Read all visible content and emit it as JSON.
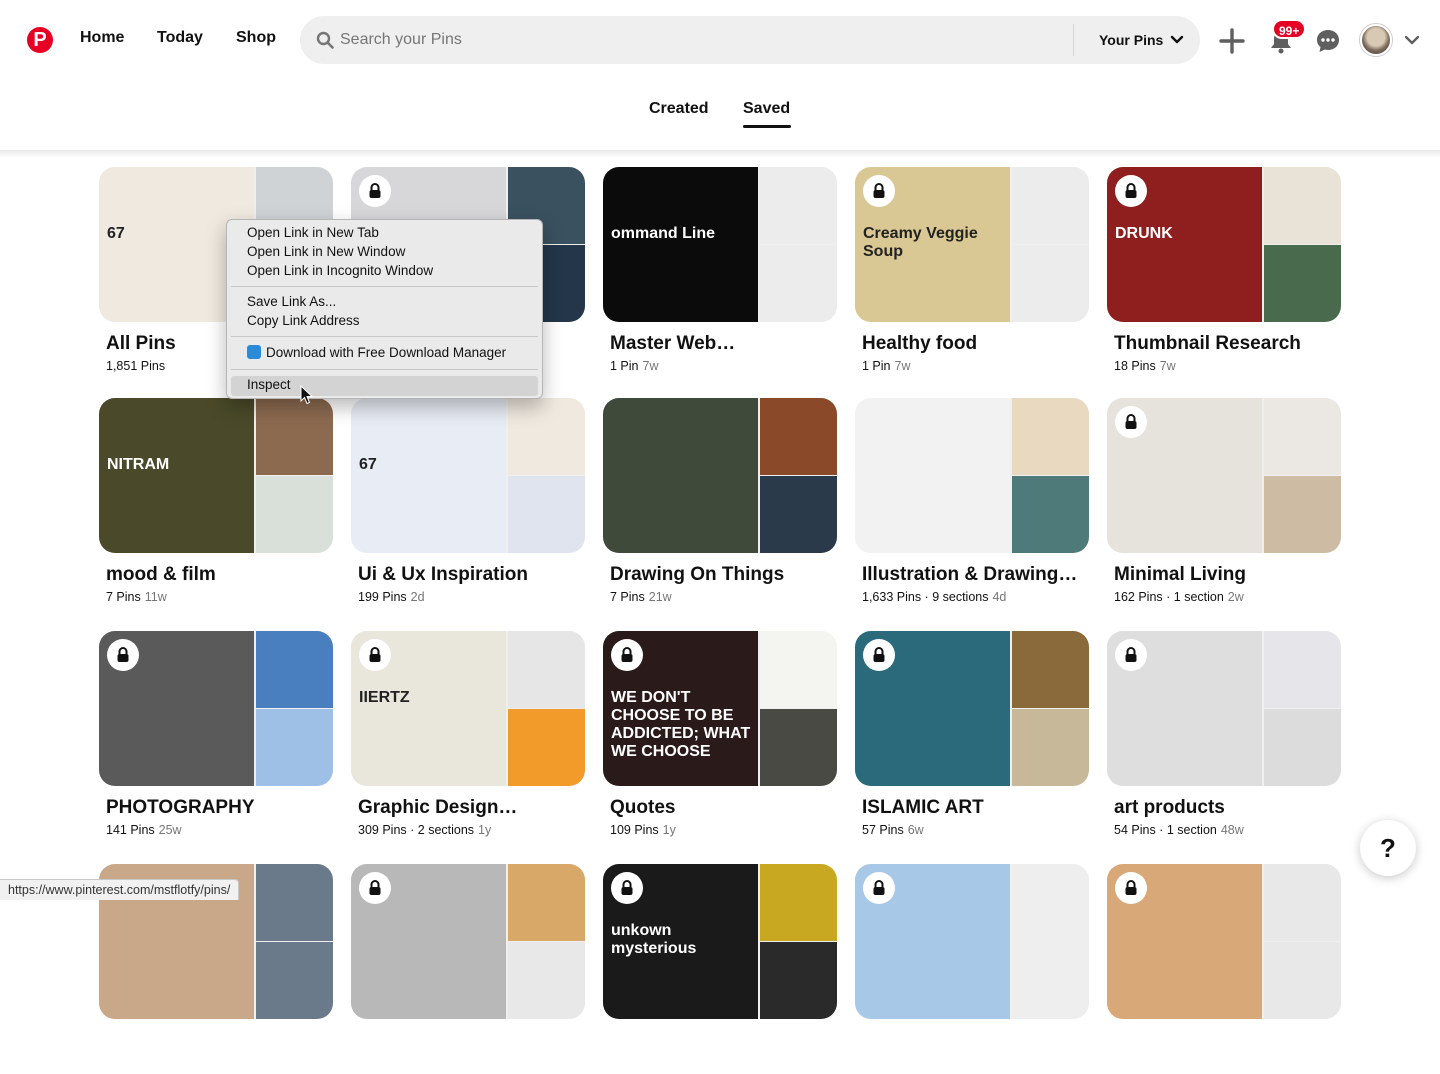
{
  "header": {
    "logo": "P",
    "nav": [
      "Home",
      "Today",
      "Shop"
    ],
    "search_placeholder": "Search your Pins",
    "your_pins": "Your Pins",
    "notifications_badge": "99+"
  },
  "tabs": {
    "created": "Created",
    "saved": "Saved",
    "active": "Saved"
  },
  "boards": [
    {
      "title": "All Pins",
      "pins": "1,851 Pins",
      "sections": "",
      "age": "",
      "locked": false,
      "colors": [
        "#efe9df",
        "#cfd3d6",
        "#e8e8ea"
      ],
      "cover_label": "67"
    },
    {
      "title": "",
      "pins": "",
      "sections": "",
      "age": "",
      "locked": true,
      "colors": [
        "#d7d7d9",
        "#3a5160",
        "#23364a"
      ],
      "cover_label": ""
    },
    {
      "title": "Master Web…",
      "pins": "1 Pin",
      "sections": "",
      "age": "7w",
      "locked": false,
      "colors": [
        "#0b0b0b",
        "#ececec",
        "#ececec"
      ],
      "cover_label": "ommand Line"
    },
    {
      "title": "Healthy food",
      "pins": "1 Pin",
      "sections": "",
      "age": "7w",
      "locked": true,
      "colors": [
        "#d9c894",
        "#ececec",
        "#ececec"
      ],
      "cover_label": "Creamy Veggie Soup"
    },
    {
      "title": "Thumbnail Research",
      "pins": "18 Pins",
      "sections": "",
      "age": "7w",
      "locked": true,
      "colors": [
        "#8f1e1e",
        "#e8e3d6",
        "#4a6a4e"
      ],
      "cover_label": "DRUNK"
    },
    {
      "title": "mood & film",
      "pins": "7 Pins",
      "sections": "",
      "age": "11w",
      "locked": false,
      "colors": [
        "#4a4a2a",
        "#8b6a50",
        "#d9e0d9"
      ],
      "cover_label": "NITRAM"
    },
    {
      "title": "Ui & Ux Inspiration",
      "pins": "199 Pins",
      "sections": "",
      "age": "2d",
      "locked": false,
      "colors": [
        "#e8ecf4",
        "#efe9df",
        "#dfe4ee"
      ],
      "cover_label": "67"
    },
    {
      "title": "Drawing On Things",
      "pins": "7 Pins",
      "sections": "",
      "age": "21w",
      "locked": false,
      "colors": [
        "#3f4a3a",
        "#8a4a2a",
        "#2a3a4a"
      ],
      "cover_label": ""
    },
    {
      "title": "Illustration & Drawing…",
      "pins": "1,633 Pins",
      "sections": "9 sections",
      "age": "4d",
      "locked": false,
      "colors": [
        "#f2f2f2",
        "#e8d9c0",
        "#4e7a7a"
      ],
      "cover_label": ""
    },
    {
      "title": "Minimal Living",
      "pins": "162 Pins",
      "sections": "1 section",
      "age": "2w",
      "locked": true,
      "colors": [
        "#e6e2dc",
        "#ebe8e4",
        "#cdbba4"
      ],
      "cover_label": ""
    },
    {
      "title": "PHOTOGRAPHY",
      "pins": "141 Pins",
      "sections": "",
      "age": "25w",
      "locked": true,
      "colors": [
        "#5a5a5a",
        "#4a7fbf",
        "#9ec0e6"
      ],
      "cover_label": ""
    },
    {
      "title": "Graphic Design…",
      "pins": "309 Pins",
      "sections": "2 sections",
      "age": "1y",
      "locked": true,
      "colors": [
        "#e9e6dc",
        "#e6e6e6",
        "#f29b2a"
      ],
      "cover_label": "IIERTZ"
    },
    {
      "title": "Quotes",
      "pins": "109 Pins",
      "sections": "",
      "age": "1y",
      "locked": true,
      "colors": [
        "#2a1a1a",
        "#f4f4f0",
        "#4a4a44"
      ],
      "cover_label": "WE DON'T CHOOSE TO BE ADDICTED; WHAT WE CHOOSE"
    },
    {
      "title": "ISLAMIC ART",
      "pins": "57 Pins",
      "sections": "",
      "age": "6w",
      "locked": true,
      "colors": [
        "#2a6a7a",
        "#8a6a3a",
        "#c8b89a"
      ],
      "cover_label": ""
    },
    {
      "title": "art products",
      "pins": "54 Pins",
      "sections": "1 section",
      "age": "48w",
      "locked": true,
      "colors": [
        "#dedede",
        "#e6e6ea",
        "#dcdcdc"
      ],
      "cover_label": ""
    },
    {
      "title": "",
      "pins": "",
      "sections": "",
      "age": "",
      "locked": false,
      "colors": [
        "#c8a888",
        "#6a7a8a",
        "#6a7a8a"
      ],
      "cover_label": ""
    },
    {
      "title": "",
      "pins": "",
      "sections": "",
      "age": "",
      "locked": true,
      "colors": [
        "#b8b8b8",
        "#d8a868",
        "#e8e8e8"
      ],
      "cover_label": ""
    },
    {
      "title": "",
      "pins": "",
      "sections": "",
      "age": "",
      "locked": true,
      "colors": [
        "#1a1a1a",
        "#c8a820",
        "#2a2a2a"
      ],
      "cover_label": "unkown mysterious"
    },
    {
      "title": "",
      "pins": "",
      "sections": "",
      "age": "",
      "locked": true,
      "colors": [
        "#a8c8e8",
        "#eeeeee",
        "#eeeeee"
      ],
      "cover_label": ""
    },
    {
      "title": "",
      "pins": "",
      "sections": "",
      "age": "",
      "locked": true,
      "colors": [
        "#d8a878",
        "#e8e8e8",
        "#e8e8e8"
      ],
      "cover_label": ""
    }
  ],
  "context_menu": {
    "items": [
      "Open Link in New Tab",
      "Open Link in New Window",
      "Open Link in Incognito Window",
      "Save Link As...",
      "Copy Link Address",
      "Download with Free Download Manager",
      "Inspect"
    ],
    "highlighted": "Inspect"
  },
  "status_bar": "https://www.pinterest.com/mstflotfy/pins/",
  "help": "?"
}
